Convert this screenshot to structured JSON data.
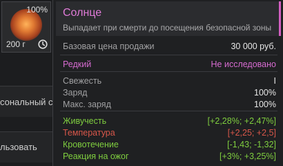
{
  "slot": {
    "charge": "100%",
    "weight": "200 г",
    "icon": "sun-artifact-icon",
    "clock_icon": "clock-icon"
  },
  "sidebar": {
    "text_1": "сональный с",
    "text_2": "льзовать"
  },
  "tooltip": {
    "title": "Солнце",
    "description": "Выпадает при смерти до посещения безопасной зоны",
    "price_label": "Базовая цена продажи",
    "price_value": "30 000 руб.",
    "rarity": "Редкий",
    "research_status": "Не исследовано",
    "stats": [
      {
        "label": "Свежесть",
        "value": "I"
      },
      {
        "label": "Заряд",
        "value": "100%"
      },
      {
        "label": "Макс. заряд",
        "value": "100%"
      }
    ],
    "effects": [
      {
        "label": "Живучесть",
        "value": "[+2,28%; +2,47%]",
        "color": "#7fce3f"
      },
      {
        "label": "Температура",
        "value": "[+2,25; +2,5]",
        "color": "#d8574a"
      },
      {
        "label": "Кровотечение",
        "value": "[-1,43; -1,32]",
        "color": "#7fce3f"
      },
      {
        "label": "Реакция на ожог",
        "value": "[+3%; +3,25%]",
        "color": "#7fce3f"
      }
    ]
  },
  "colors": {
    "accent": "#d25fc1",
    "rarity": "#d66bd0",
    "positive": "#7fce3f",
    "negative": "#d8574a"
  }
}
